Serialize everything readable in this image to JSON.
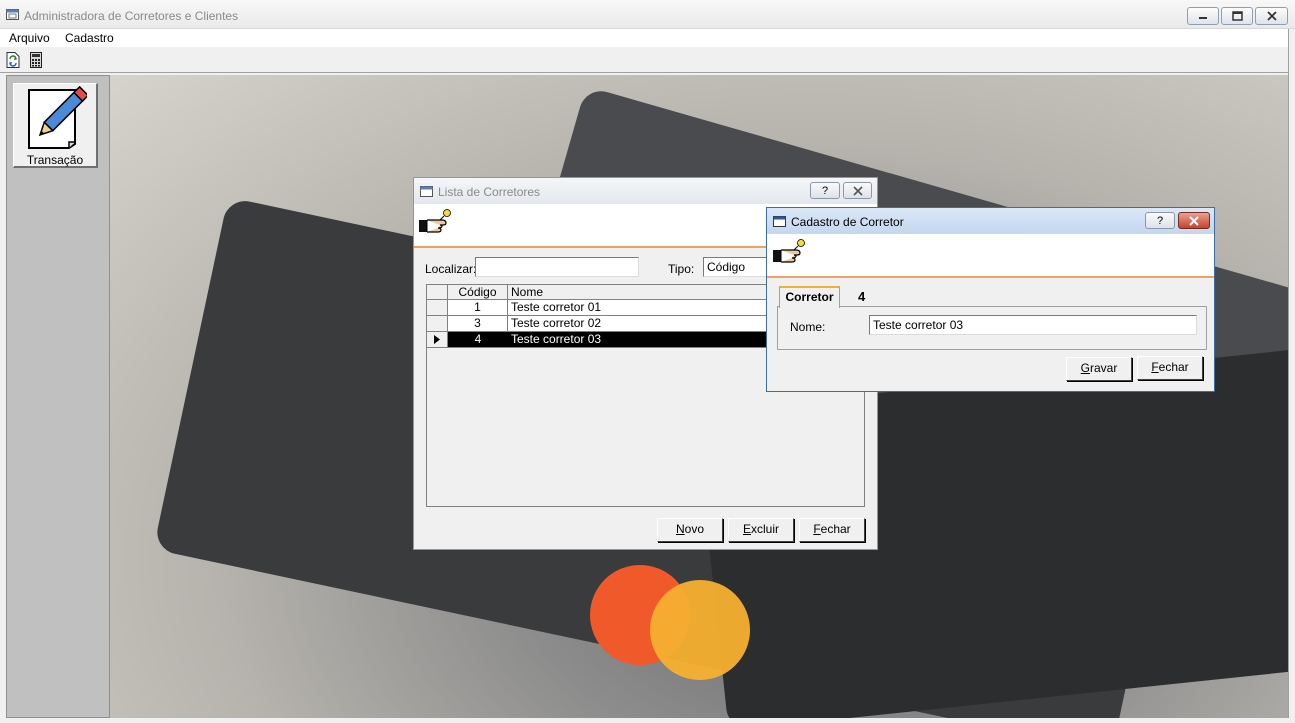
{
  "main_window": {
    "title": "Administradora de Corretores e Clientes"
  },
  "menu": {
    "items": [
      "Arquivo",
      "Cadastro"
    ]
  },
  "toolbar": {
    "icons": [
      "refresh-icon",
      "calculator-icon"
    ]
  },
  "sidebar": {
    "button_label": "Transação"
  },
  "lista_window": {
    "title": "Lista de Corretores",
    "help_label": "?",
    "localizar_label": "Localizar:",
    "localizar_value": "",
    "tipo_label": "Tipo:",
    "tipo_value": "Código",
    "columns": [
      "Código",
      "Nome"
    ],
    "rows": [
      {
        "codigo": "1",
        "nome": "Teste corretor 01"
      },
      {
        "codigo": "3",
        "nome": "Teste corretor 02"
      },
      {
        "codigo": "4",
        "nome": "Teste corretor 03"
      }
    ],
    "buttons": {
      "novo_u": "N",
      "novo_rest": "ovo",
      "excluir_u": "E",
      "excluir_rest": "xcluir",
      "fechar_u": "F",
      "fechar_rest": "echar"
    }
  },
  "cadastro_window": {
    "title": "Cadastro de Corretor",
    "help_label": "?",
    "tab_label": "Corretor",
    "record_id": "4",
    "nome_label": "Nome:",
    "nome_value": "Teste corretor 03",
    "buttons": {
      "gravar_u": "G",
      "gravar_rest": "ravar",
      "fechar_u": "F",
      "fechar_rest": "echar"
    }
  },
  "colors": {
    "accent_line": "#f0a060",
    "selected_row": "#000000",
    "close_red": "#c7432b"
  }
}
